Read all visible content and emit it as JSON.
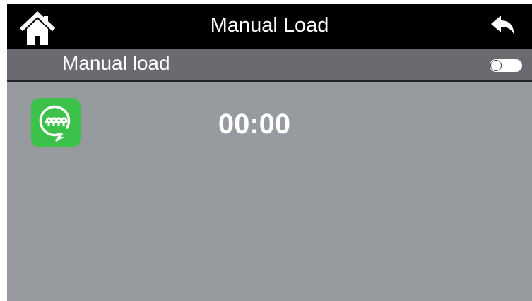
{
  "header": {
    "title": "Manual Load",
    "home_icon": "home-icon",
    "back_icon": "back-arrow-icon"
  },
  "setting": {
    "label": "Manual load",
    "toggle_state": "off"
  },
  "status": {
    "icon": "auger-icon",
    "timer": "00:00"
  },
  "colors": {
    "header_bg": "#000000",
    "subheader_bg": "#696b70",
    "screen_bg": "#979a9e",
    "icon_green": "#3cc24b",
    "text": "#ffffff"
  }
}
